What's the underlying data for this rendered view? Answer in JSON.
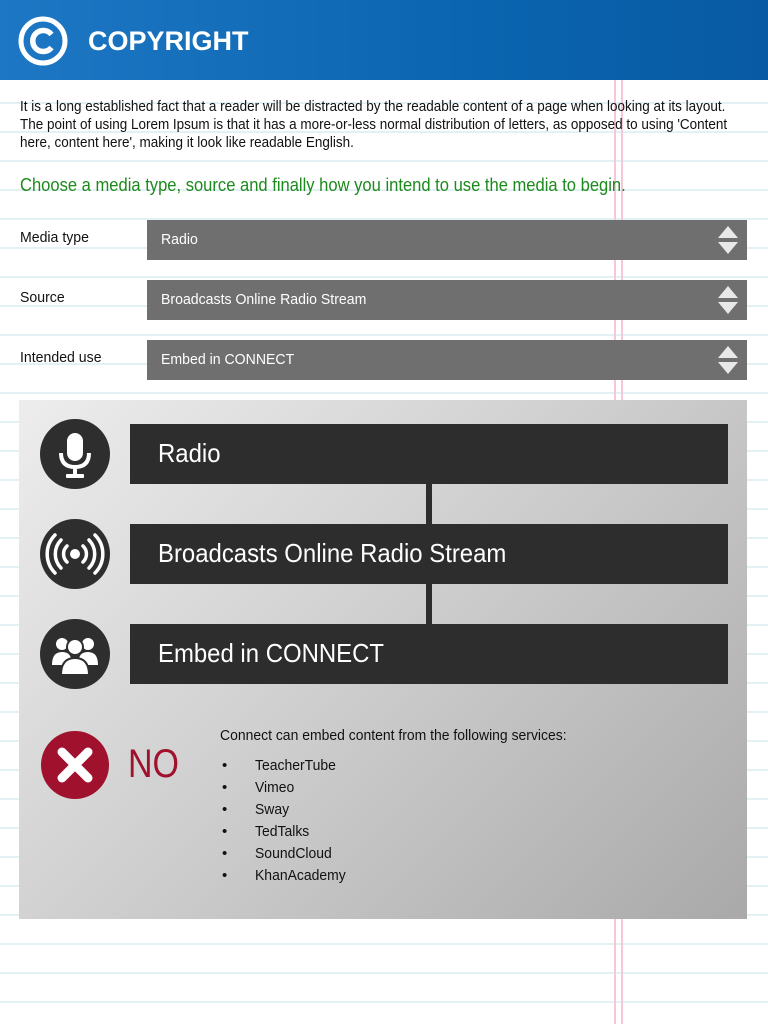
{
  "header": {
    "title": "COPYRIGHT",
    "logo_icon": "copyright-icon"
  },
  "intro": {
    "text": "It is a long established fact that a reader will be distracted by the readable content of a page when looking at its layout. The point of using Lorem Ipsum is that it has a more-or-less normal distribution of letters, as opposed to using 'Content here, content here', making it look like readable English."
  },
  "instruction": {
    "text": "Choose a media type, source and finally how you intend to use the media to begin."
  },
  "fields": [
    {
      "label": "Media type",
      "value": "Radio"
    },
    {
      "label": "Source",
      "value": "Broadcasts Online Radio Stream"
    },
    {
      "label": "Intended use",
      "value": "Embed in CONNECT"
    }
  ],
  "steps": [
    {
      "icon": "microphone-icon",
      "label": "Radio"
    },
    {
      "icon": "broadcast-icon",
      "label": "Broadcasts Online Radio Stream"
    },
    {
      "icon": "group-icon",
      "label": "Embed in CONNECT"
    }
  ],
  "result": {
    "icon": "x-circle-icon",
    "label": "NO",
    "services_intro": "Connect can embed content from the following services:",
    "bullet": "•",
    "services": [
      "TeacherTube",
      "Vimeo",
      "Sway",
      "TedTalks",
      "SoundCloud",
      "KhanAcademy"
    ]
  },
  "colors": {
    "header_blue": "#0b65b0",
    "instruction_green": "#1d8a1d",
    "select_gray": "#6f6f6f",
    "step_dark": "#2d2d2d",
    "no_red": "#a0112d"
  }
}
